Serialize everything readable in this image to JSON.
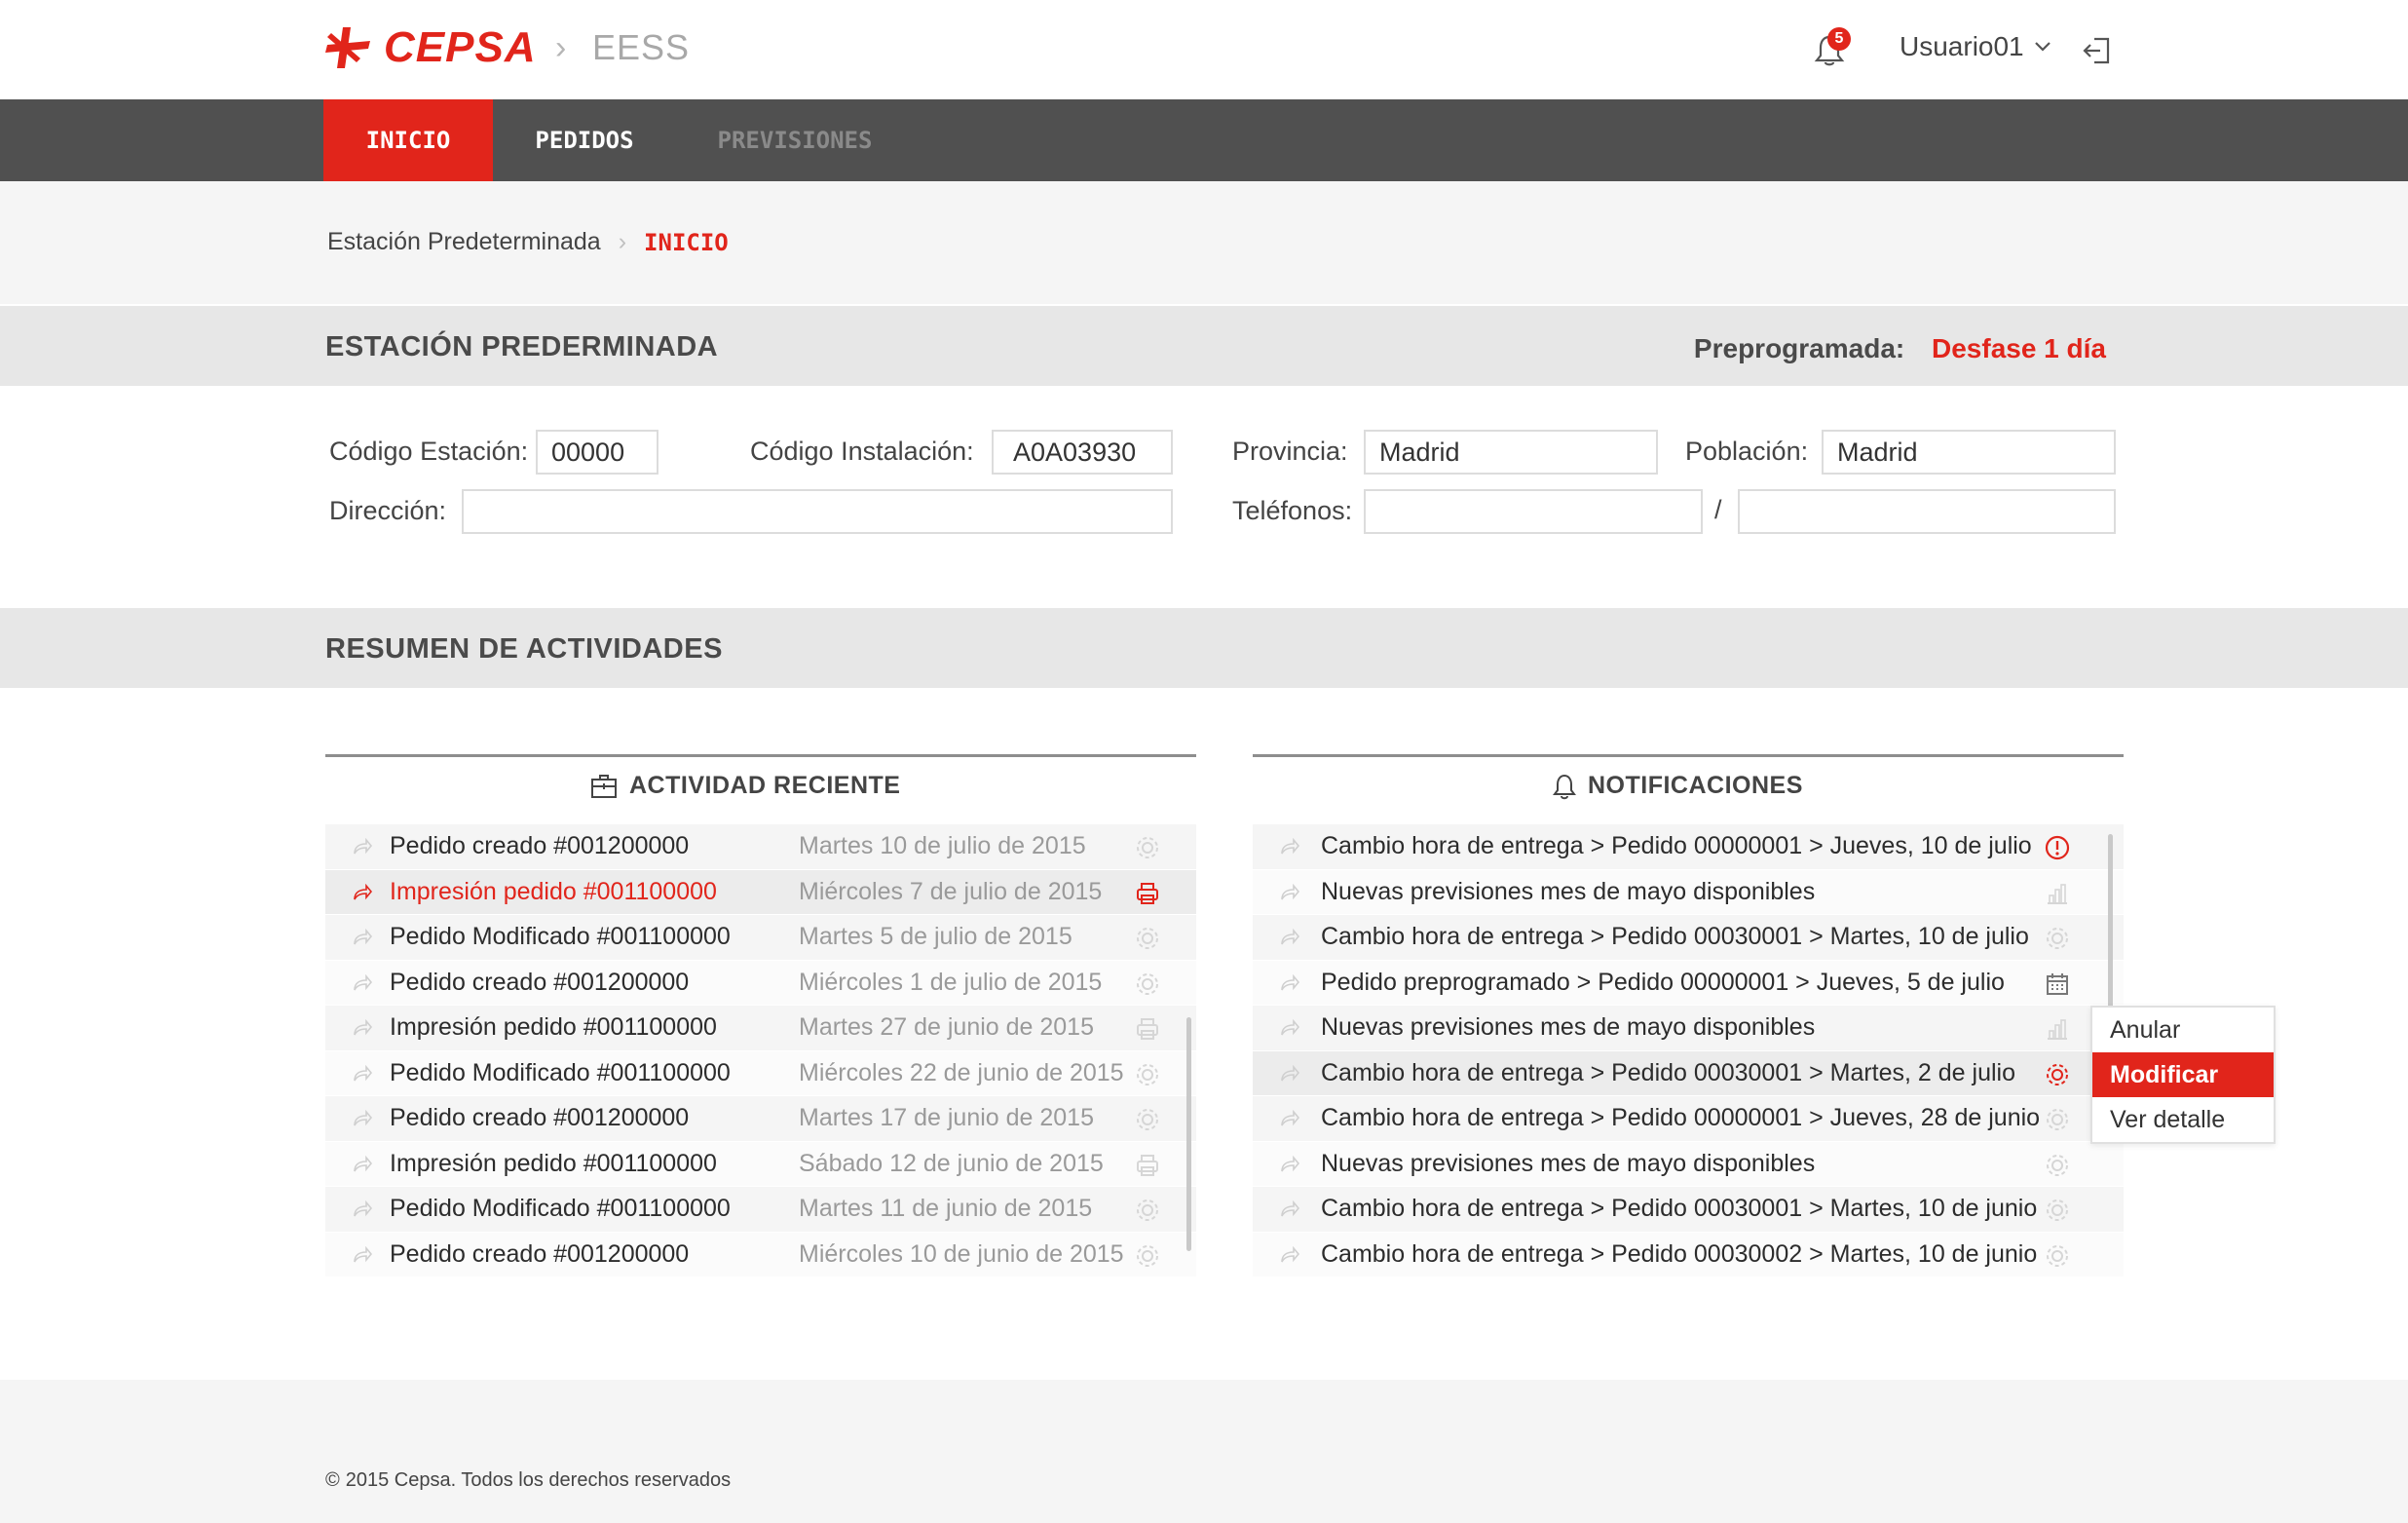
{
  "header": {
    "logo_text": "CEPSA",
    "breadcrumb_sep": "›",
    "app_name": "EESS",
    "notification_count": "5",
    "user_name": "Usuario01",
    "brand_color": "#e1251b"
  },
  "nav": {
    "tabs": [
      {
        "label": "INICIO",
        "active": true
      },
      {
        "label": "PEDIDOS",
        "active": false
      },
      {
        "label": "PREVISIONES",
        "active": false,
        "disabled": true
      }
    ]
  },
  "breadcrumb": {
    "items": [
      "Estación Predeterminada",
      "INICIO"
    ],
    "sep": "›"
  },
  "station": {
    "section_title": "ESTACIÓN PREDERMINADA",
    "preprogramada_label": "Preprogramada:",
    "preprogramada_value": "Desfase 1 día",
    "codigo_estacion_label": "Código Estación:",
    "codigo_estacion_value": "00000",
    "codigo_instalacion_label": "Código Instalación:",
    "codigo_instalacion_value": "A0A03930",
    "provincia_label": "Provincia:",
    "provincia_value": "Madrid",
    "poblacion_label": "Población:",
    "poblacion_value": "Madrid",
    "direccion_label": "Dirección:",
    "direccion_value": "",
    "telefonos_label": "Teléfonos:",
    "telefono1_value": "",
    "telefono_sep": "/",
    "telefono2_value": ""
  },
  "summary": {
    "section_title": "RESUMEN DE ACTIVIDADES"
  },
  "activity": {
    "title": "ACTIVIDAD RECIENTE",
    "rows": [
      {
        "text": "Pedido creado #001200000",
        "date": "Martes 10 de julio de 2015",
        "icon": "gear-icon"
      },
      {
        "text": "Impresión pedido #001100000",
        "date": "Miércoles 7 de julio de 2015",
        "icon": "printer-icon",
        "highlight": true
      },
      {
        "text": "Pedido Modificado #001100000",
        "date": "Martes 5 de julio de 2015",
        "icon": "gear-icon"
      },
      {
        "text": "Pedido creado #001200000",
        "date": "Miércoles 1 de julio de 2015",
        "icon": "gear-icon"
      },
      {
        "text": "Impresión pedido #001100000",
        "date": "Martes 27 de junio de 2015",
        "icon": "printer-icon"
      },
      {
        "text": "Pedido Modificado #001100000",
        "date": "Miércoles 22 de junio de 2015",
        "icon": "gear-icon"
      },
      {
        "text": "Pedido creado #001200000",
        "date": "Martes 17 de junio de 2015",
        "icon": "gear-icon"
      },
      {
        "text": "Impresión pedido #001100000",
        "date": "Sábado 12 de junio de 2015",
        "icon": "printer-icon"
      },
      {
        "text": "Pedido Modificado #001100000",
        "date": "Martes 11 de junio de 2015",
        "icon": "gear-icon"
      },
      {
        "text": "Pedido creado #001200000",
        "date": "Miércoles 10 de junio de 2015",
        "icon": "gear-icon"
      }
    ]
  },
  "notifications": {
    "title": "NOTIFICACIONES",
    "rows": [
      {
        "text": "Cambio hora de entrega > Pedido 00000001 > Jueves, 10 de julio",
        "icon": "alert-circle-icon"
      },
      {
        "text": "Nuevas previsiones mes de mayo disponibles",
        "icon": "bar-chart-icon"
      },
      {
        "text": "Cambio hora de entrega > Pedido 00030001 > Martes, 10 de julio",
        "icon": "gear-icon"
      },
      {
        "text": "Pedido preprogramado > Pedido 00000001 > Jueves, 5 de julio",
        "icon": "calendar-icon"
      },
      {
        "text": "Nuevas previsiones mes de mayo disponibles",
        "icon": "bar-chart-icon"
      },
      {
        "text": "Cambio hora de entrega > Pedido 00030001 > Martes, 2 de julio",
        "icon": "gear-icon",
        "highlight": true
      },
      {
        "text": "Cambio hora de entrega > Pedido 00000001 > Jueves, 28 de junio",
        "icon": "gear-icon"
      },
      {
        "text": "Nuevas previsiones mes de mayo disponibles",
        "icon": "gear-icon"
      },
      {
        "text": "Cambio hora de entrega > Pedido 00030001 > Martes, 10 de junio",
        "icon": "gear-icon"
      },
      {
        "text": "Cambio hora de entrega > Pedido 00030002 > Martes, 10 de junio",
        "icon": "gear-icon"
      }
    ]
  },
  "context_menu": {
    "items": [
      {
        "label": "Anular",
        "active": false
      },
      {
        "label": "Modificar",
        "active": true
      },
      {
        "label": "Ver detalle",
        "active": false
      }
    ]
  },
  "footer": {
    "copyright_symbol": "©",
    "text": "2015 Cepsa. Todos los derechos reservados"
  }
}
